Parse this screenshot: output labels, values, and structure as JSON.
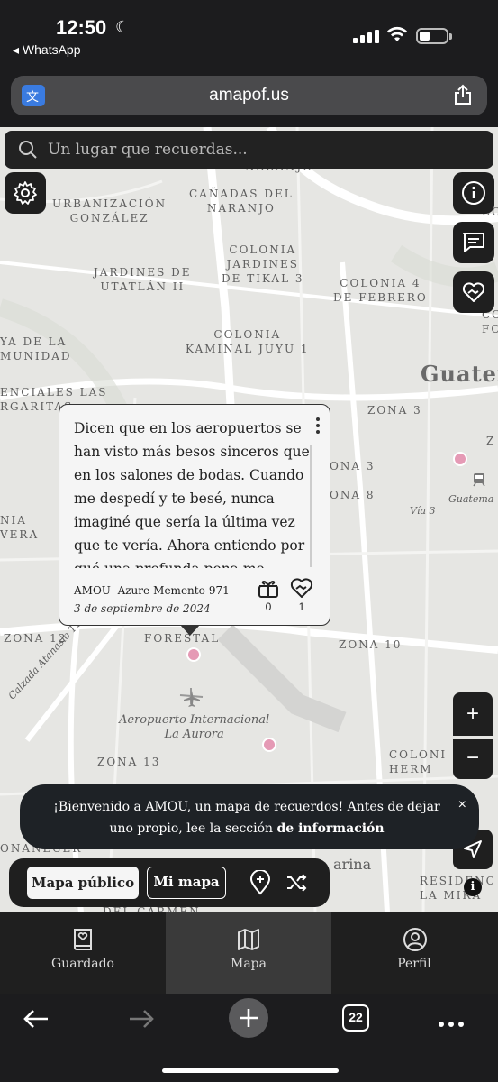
{
  "status": {
    "time": "12:50",
    "back_app": "◂ WhatsApp"
  },
  "browser": {
    "url": "amapof.us",
    "tab_count": "22"
  },
  "search": {
    "placeholder": "Un lugar que recuerdas..."
  },
  "map_labels": {
    "l1": "NARANJO",
    "l2": "URBANIZACIÓN\nGONZÁLEZ",
    "l3": "CAÑADAS DEL\nNARANJO",
    "l4": "COLONIA\nJARDINES\nDE TIKAL 3",
    "l5": "JARDINES DE\nUTATLÁN II",
    "l6": "COLONIA 4\nDE FEBRERO",
    "l7": "COLONIA\nKAMINAL JUYU 1",
    "l8": "YA DE LA\nMUNIDAD",
    "l9": "Guater",
    "l10": "ENCIALES LAS\nRGARITAS",
    "l11": "ZONA 3",
    "l12": "ONA 3",
    "l13": "ONA 8",
    "l14": "Vía 3",
    "l15": "Guatema",
    "l16": "NIA\nVERA",
    "l17": "ZONA 12",
    "l18": "FORESTAL",
    "l19": "ZONA 10",
    "l20": "Calzada Atanasio Tzul",
    "l21": "Aeropuerto Internacional\nLa Aurora",
    "l22": "ZONA 13",
    "l23": "COLONI\nHERM",
    "l24": "ONANECER",
    "l25": "arina",
    "l26": "RESIDENC\nLA MIRA",
    "l27": "DEL CARMEN",
    "l28": "COLO",
    "l29": "COLO\nFOR",
    "l30": "Z"
  },
  "popup": {
    "text": "Dicen que en los aeropuertos se han visto más besos sinceros que en los salones de bodas. Cuando me despedí y te besé, nunca imaginé que sería la última vez que te vería. Ahora entiendo por qué una profunda pena me invadió de",
    "author": "AMOU- Azure-Memento-971",
    "date": "3 de septiembre de 2024",
    "saves": "0",
    "hearts": "1"
  },
  "zoom": {
    "in": "+",
    "out": "−"
  },
  "attribution": "i",
  "toast": {
    "text": "¡Bienvenido a AMOU, un mapa de recuerdos! Antes de dejar uno propio, lee la sección ",
    "link": "de información",
    "close": "×"
  },
  "map_toggle": {
    "public": "Mapa público",
    "mine": "Mi mapa"
  },
  "nav": {
    "saved": "Guardado",
    "map": "Mapa",
    "profile": "Perfil"
  },
  "colors": {
    "pin": "#e59ab5",
    "map_bg": "#e6e6e3",
    "dark_ui": "#1f1f1f"
  }
}
